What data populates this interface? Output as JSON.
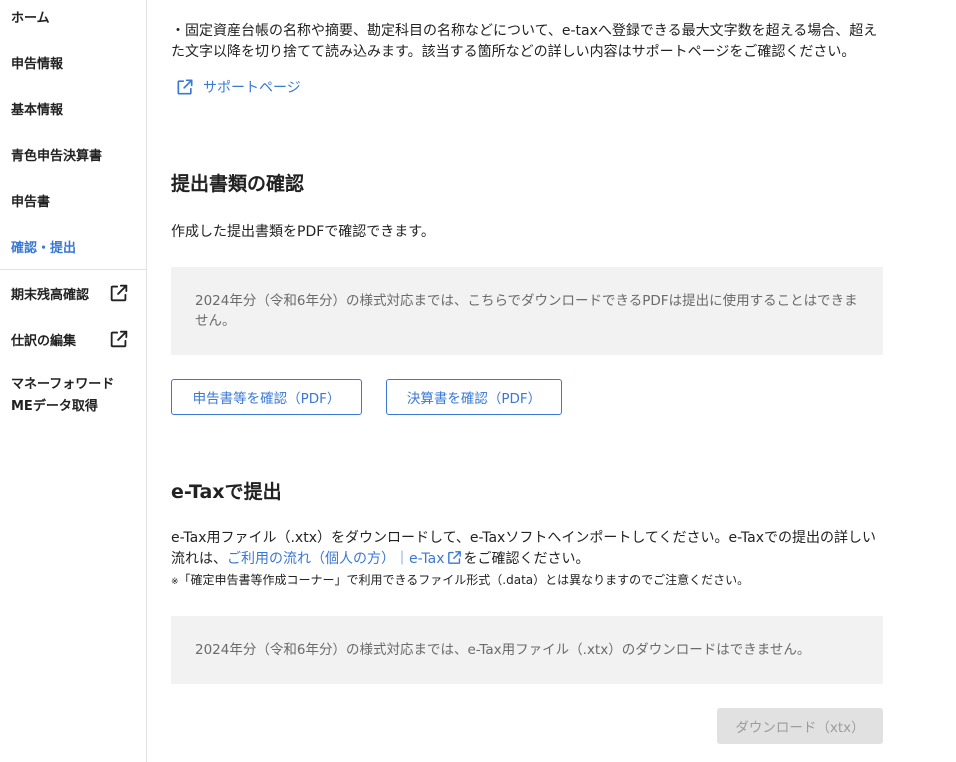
{
  "sidebar": {
    "items": [
      {
        "label": "ホーム"
      },
      {
        "label": "申告情報"
      },
      {
        "label": "基本情報"
      },
      {
        "label": "青色申告決算書"
      },
      {
        "label": "申告書"
      },
      {
        "label": "確認・提出",
        "active": true
      }
    ],
    "external_items": [
      {
        "label": "期末残高確認",
        "icon": "external-link-icon"
      },
      {
        "label": "仕訳の編集",
        "icon": "external-link-icon"
      }
    ],
    "mf_item": {
      "line1": "マネーフォワード",
      "line2": "MEデータ取得"
    }
  },
  "notice_top": {
    "text": "・固定資産台帳の名称や摘要、勘定科目の名称などについて、e-taxへ登録できる最大文字数を超える場合、超えた文字以降を切り捨てて読み込みます。該当する箇所などの詳しい内容はサポートページをご確認ください。",
    "support_link": "サポートページ",
    "support_icon": "external-link-icon"
  },
  "confirm_section": {
    "title": "提出書類の確認",
    "description": "作成した提出書類をPDFで確認できます。",
    "notice": "2024年分（令和6年分）の様式対応までは、こちらでダウンロードできるPDFは提出に使用することはできません。",
    "buttons": {
      "declaration_pdf": "申告書等を確認（PDF）",
      "settlement_pdf": "決算書を確認（PDF）"
    }
  },
  "etax_section": {
    "title": "e-Taxで提出",
    "description_part1": "e-Tax用ファイル（.xtx）をダウンロードして、e-Taxソフトへインポートしてください。e-Taxでの提出の詳しい流れは、",
    "flow_link": "ご利用の流れ（個人の方）｜e-Tax",
    "description_part2": "をご確認ください。",
    "note_mark": "※",
    "note": "「確定申告書等作成コーナー」で利用できるファイル形式（.data）とは異なりますのでご注意ください。",
    "notice": "2024年分（令和6年分）の様式対応までは、e-Tax用ファイル（.xtx）のダウンロードはできません。",
    "download_button": "ダウンロード（xtx）"
  },
  "colors": {
    "accent": "#3a78d6",
    "notice_bg": "#f2f2f2",
    "disabled_bg": "#e1e1e1"
  }
}
